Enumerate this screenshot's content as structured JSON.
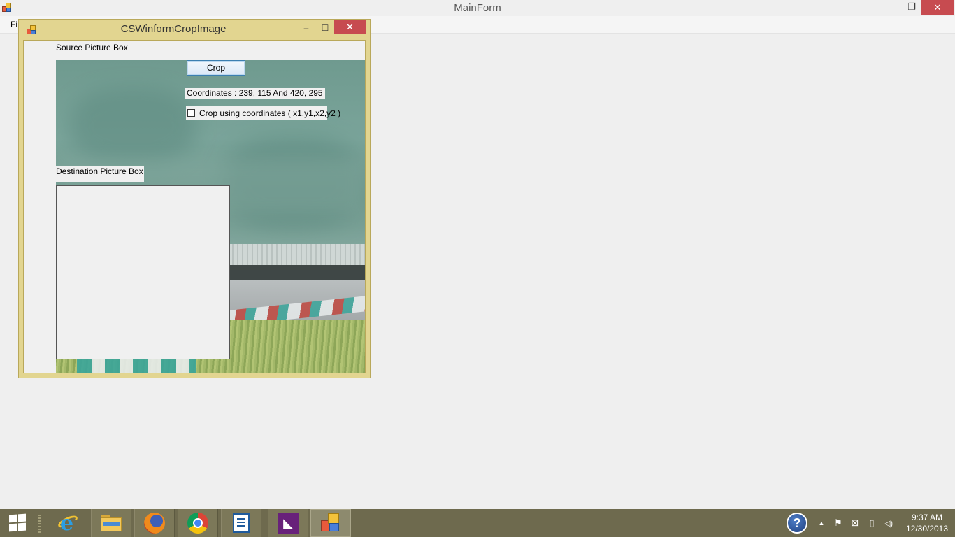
{
  "main_window": {
    "title": "MainForm",
    "menu": {
      "file_label": "Fi"
    },
    "controls": {
      "minimize": "–",
      "restore": "❐",
      "close": "✕"
    }
  },
  "child_window": {
    "title": "CSWinformCropImage",
    "controls": {
      "minimize": "–",
      "maximize": "☐",
      "close": "✕"
    },
    "source_label": "Source Picture Box",
    "destination_label": "Destination Picture Box",
    "crop_button": "Crop",
    "coordinates_text": "Coordinates  :  239, 115 And 420, 295",
    "checkbox": {
      "label": "Crop using coordinates ( x1,y1,x2,y2 )",
      "checked": false
    }
  },
  "taskbar": {
    "items": [
      {
        "name": "start",
        "icon": "windows-logo-icon"
      },
      {
        "name": "internet-explorer",
        "icon": "internet-explorer-icon"
      },
      {
        "name": "file-explorer",
        "icon": "folder-icon"
      },
      {
        "name": "firefox",
        "icon": "firefox-icon"
      },
      {
        "name": "chrome",
        "icon": "chrome-icon"
      },
      {
        "name": "document",
        "icon": "document-icon"
      },
      {
        "name": "visual-studio",
        "icon": "visual-studio-icon",
        "glyph": "◣"
      },
      {
        "name": "cswinformcropimage",
        "icon": "app-icon",
        "active": true
      }
    ],
    "tray": {
      "help_glyph": "?",
      "show_hidden": "▲",
      "flag": "⚑",
      "network": "⊠",
      "power": "▯",
      "volume": "◁)"
    },
    "clock": {
      "time": "9:37 AM",
      "date": "12/30/2013"
    }
  },
  "colors": {
    "child_frame": "#e2d590",
    "close_button": "#c74b50",
    "taskbar": "#6e6a4e",
    "crop_button_border": "#3c7fb1"
  }
}
